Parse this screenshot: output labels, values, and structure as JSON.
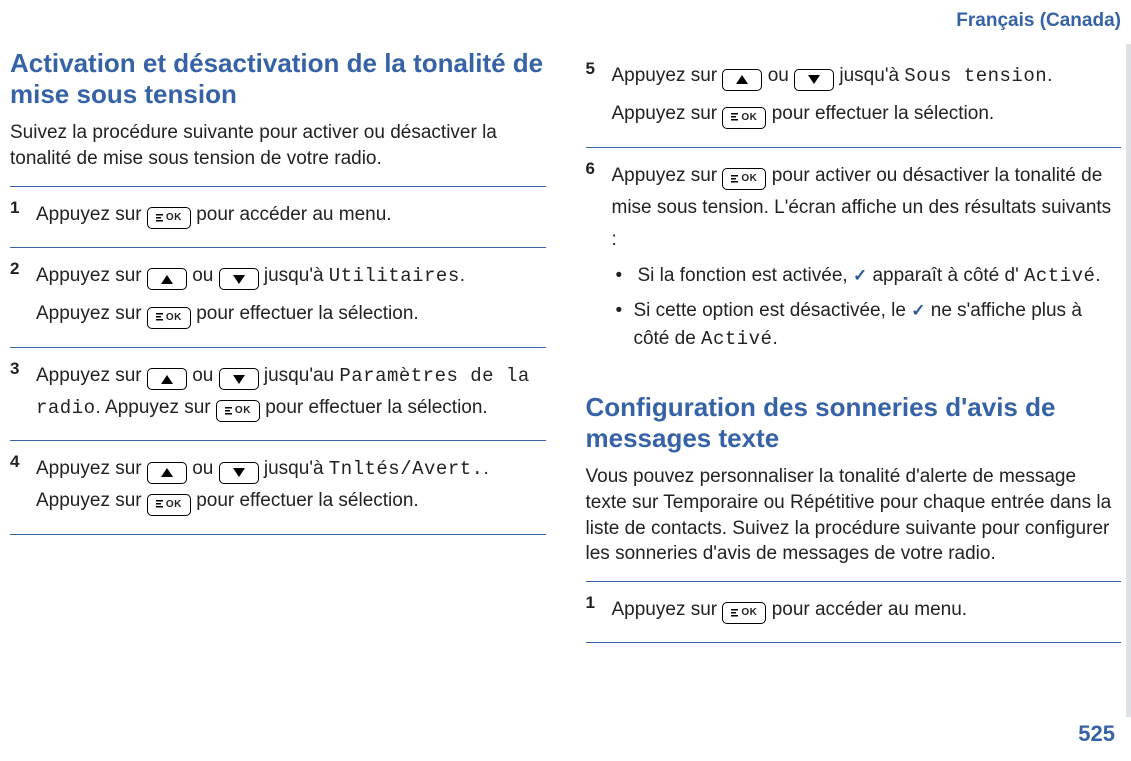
{
  "header": {
    "language": "Français (Canada)"
  },
  "page_number": "525",
  "left": {
    "title": "Activation et désactivation de la tonalité de mise sous tension",
    "lead": "Suivez la procédure suivante pour activer ou désactiver la tonalité de mise sous tension de votre radio.",
    "steps": {
      "s1": {
        "num": "1",
        "a": "Appuyez sur ",
        "b": " pour accéder au menu."
      },
      "s2": {
        "num": "2",
        "a": "Appuyez sur ",
        "b": " ou ",
        "c": " jusqu'à ",
        "menu": "Utilitaires",
        "d": ". Appuyez sur ",
        "e": " pour effectuer la sélection."
      },
      "s3": {
        "num": "3",
        "a": "Appuyez sur ",
        "b": " ou ",
        "c": " jusqu'au ",
        "menu": "Paramètres de la radio",
        "d": ". Appuyez sur ",
        "e": " pour effectuer la sélection."
      },
      "s4": {
        "num": "4",
        "a": "Appuyez sur ",
        "b": " ou ",
        "c": " jusqu'à ",
        "menu": "Tnltés/Avert.",
        "d": ". Appuyez sur ",
        "e": " pour effectuer la sélection."
      }
    }
  },
  "right": {
    "steps": {
      "s5": {
        "num": "5",
        "a": "Appuyez sur ",
        "b": " ou ",
        "c": " jusqu'à ",
        "menu": "Sous tension",
        "d": ". Appuyez sur ",
        "e": " pour effectuer la sélection."
      },
      "s6": {
        "num": "6",
        "a": "Appuyez sur ",
        "b": " pour activer ou désactiver la tonalité de mise sous tension. L'écran affiche un des résultats suivants :",
        "bul1a": "Si la fonction est activée, ",
        "bul1b": " apparaît à côté d'",
        "bul1m": "Activé",
        "bul1c": ".",
        "bul2a": "Si cette option est désactivée, le ",
        "bul2b": " ne s'affiche plus à côté de ",
        "bul2m": "Activé",
        "bul2c": "."
      }
    },
    "section2": {
      "title": "Configuration des sonneries d'avis de messages texte",
      "lead": "Vous pouvez personnaliser la tonalité d'alerte de message texte sur Temporaire ou Répétitive pour chaque entrée dans la liste de contacts. Suivez la procédure suivante pour configurer les sonneries d'avis de messages de votre radio.",
      "s1": {
        "num": "1",
        "a": "Appuyez sur ",
        "b": " pour accéder au menu."
      }
    }
  },
  "glyphs": {
    "check": "✓",
    "bullet": "•"
  }
}
